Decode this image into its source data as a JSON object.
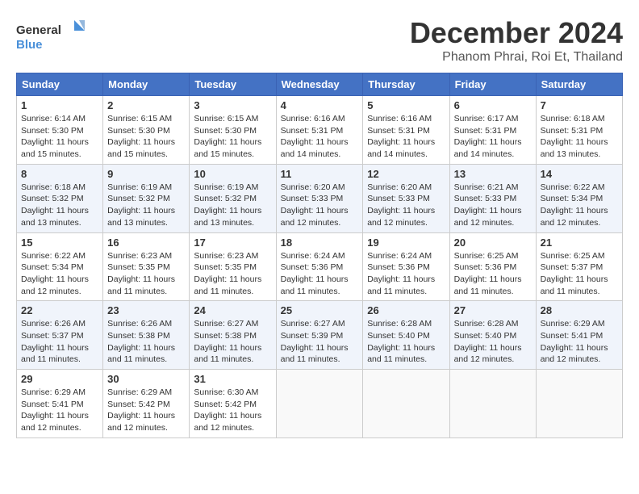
{
  "header": {
    "logo_general": "General",
    "logo_blue": "Blue",
    "month_title": "December 2024",
    "subtitle": "Phanom Phrai, Roi Et, Thailand"
  },
  "days_of_week": [
    "Sunday",
    "Monday",
    "Tuesday",
    "Wednesday",
    "Thursday",
    "Friday",
    "Saturday"
  ],
  "weeks": [
    [
      {
        "day": 1,
        "sunrise": "6:14 AM",
        "sunset": "5:30 PM",
        "daylight": "11 hours and 15 minutes."
      },
      {
        "day": 2,
        "sunrise": "6:15 AM",
        "sunset": "5:30 PM",
        "daylight": "11 hours and 15 minutes."
      },
      {
        "day": 3,
        "sunrise": "6:15 AM",
        "sunset": "5:30 PM",
        "daylight": "11 hours and 15 minutes."
      },
      {
        "day": 4,
        "sunrise": "6:16 AM",
        "sunset": "5:31 PM",
        "daylight": "11 hours and 14 minutes."
      },
      {
        "day": 5,
        "sunrise": "6:16 AM",
        "sunset": "5:31 PM",
        "daylight": "11 hours and 14 minutes."
      },
      {
        "day": 6,
        "sunrise": "6:17 AM",
        "sunset": "5:31 PM",
        "daylight": "11 hours and 14 minutes."
      },
      {
        "day": 7,
        "sunrise": "6:18 AM",
        "sunset": "5:31 PM",
        "daylight": "11 hours and 13 minutes."
      }
    ],
    [
      {
        "day": 8,
        "sunrise": "6:18 AM",
        "sunset": "5:32 PM",
        "daylight": "11 hours and 13 minutes."
      },
      {
        "day": 9,
        "sunrise": "6:19 AM",
        "sunset": "5:32 PM",
        "daylight": "11 hours and 13 minutes."
      },
      {
        "day": 10,
        "sunrise": "6:19 AM",
        "sunset": "5:32 PM",
        "daylight": "11 hours and 13 minutes."
      },
      {
        "day": 11,
        "sunrise": "6:20 AM",
        "sunset": "5:33 PM",
        "daylight": "11 hours and 12 minutes."
      },
      {
        "day": 12,
        "sunrise": "6:20 AM",
        "sunset": "5:33 PM",
        "daylight": "11 hours and 12 minutes."
      },
      {
        "day": 13,
        "sunrise": "6:21 AM",
        "sunset": "5:33 PM",
        "daylight": "11 hours and 12 minutes."
      },
      {
        "day": 14,
        "sunrise": "6:22 AM",
        "sunset": "5:34 PM",
        "daylight": "11 hours and 12 minutes."
      }
    ],
    [
      {
        "day": 15,
        "sunrise": "6:22 AM",
        "sunset": "5:34 PM",
        "daylight": "11 hours and 12 minutes."
      },
      {
        "day": 16,
        "sunrise": "6:23 AM",
        "sunset": "5:35 PM",
        "daylight": "11 hours and 11 minutes."
      },
      {
        "day": 17,
        "sunrise": "6:23 AM",
        "sunset": "5:35 PM",
        "daylight": "11 hours and 11 minutes."
      },
      {
        "day": 18,
        "sunrise": "6:24 AM",
        "sunset": "5:36 PM",
        "daylight": "11 hours and 11 minutes."
      },
      {
        "day": 19,
        "sunrise": "6:24 AM",
        "sunset": "5:36 PM",
        "daylight": "11 hours and 11 minutes."
      },
      {
        "day": 20,
        "sunrise": "6:25 AM",
        "sunset": "5:36 PM",
        "daylight": "11 hours and 11 minutes."
      },
      {
        "day": 21,
        "sunrise": "6:25 AM",
        "sunset": "5:37 PM",
        "daylight": "11 hours and 11 minutes."
      }
    ],
    [
      {
        "day": 22,
        "sunrise": "6:26 AM",
        "sunset": "5:37 PM",
        "daylight": "11 hours and 11 minutes."
      },
      {
        "day": 23,
        "sunrise": "6:26 AM",
        "sunset": "5:38 PM",
        "daylight": "11 hours and 11 minutes."
      },
      {
        "day": 24,
        "sunrise": "6:27 AM",
        "sunset": "5:38 PM",
        "daylight": "11 hours and 11 minutes."
      },
      {
        "day": 25,
        "sunrise": "6:27 AM",
        "sunset": "5:39 PM",
        "daylight": "11 hours and 11 minutes."
      },
      {
        "day": 26,
        "sunrise": "6:28 AM",
        "sunset": "5:40 PM",
        "daylight": "11 hours and 11 minutes."
      },
      {
        "day": 27,
        "sunrise": "6:28 AM",
        "sunset": "5:40 PM",
        "daylight": "11 hours and 12 minutes."
      },
      {
        "day": 28,
        "sunrise": "6:29 AM",
        "sunset": "5:41 PM",
        "daylight": "11 hours and 12 minutes."
      }
    ],
    [
      {
        "day": 29,
        "sunrise": "6:29 AM",
        "sunset": "5:41 PM",
        "daylight": "11 hours and 12 minutes."
      },
      {
        "day": 30,
        "sunrise": "6:29 AM",
        "sunset": "5:42 PM",
        "daylight": "11 hours and 12 minutes."
      },
      {
        "day": 31,
        "sunrise": "6:30 AM",
        "sunset": "5:42 PM",
        "daylight": "11 hours and 12 minutes."
      },
      null,
      null,
      null,
      null
    ]
  ],
  "labels": {
    "sunrise": "Sunrise:",
    "sunset": "Sunset:",
    "daylight": "Daylight:"
  }
}
